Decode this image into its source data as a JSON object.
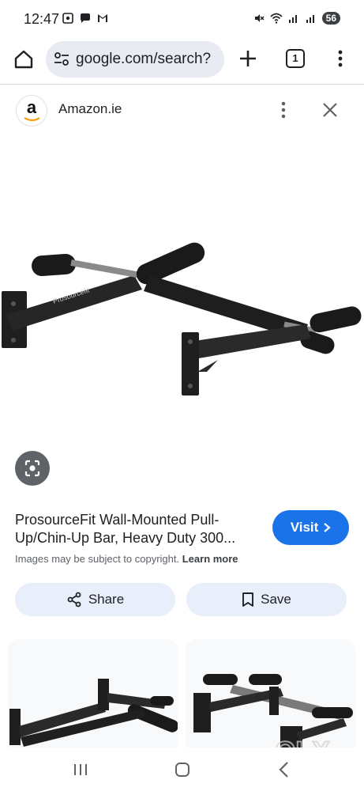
{
  "status_bar": {
    "time": "12:47",
    "battery": "56",
    "left_icons": [
      "screenshot-icon",
      "chat-bubble-icon",
      "gmail-icon"
    ],
    "right_icons": [
      "mute-icon",
      "wifi-icon",
      "signal-icon",
      "signal-icon"
    ]
  },
  "browser": {
    "url": "google.com/search?",
    "tab_count": "1"
  },
  "source": {
    "logo_letter": "a",
    "name": "Amazon.ie"
  },
  "result": {
    "title": "ProsourceFit Wall-Mounted Pull-Up/Chin-Up Bar, Heavy Duty 300...",
    "visit_label": "Visit",
    "copyright_text": "Images may be subject to copyright.",
    "learn_more": "Learn more",
    "share_label": "Share",
    "save_label": "Save"
  },
  "product_image": {
    "brand_mark": "Prosourcefit"
  },
  "watermark": "OLX",
  "colors": {
    "accent": "#1a73e8",
    "chip_bg": "#e8eefa",
    "omnibox_bg": "#e8ebf2",
    "text": "#202124",
    "muted": "#5f6368"
  }
}
